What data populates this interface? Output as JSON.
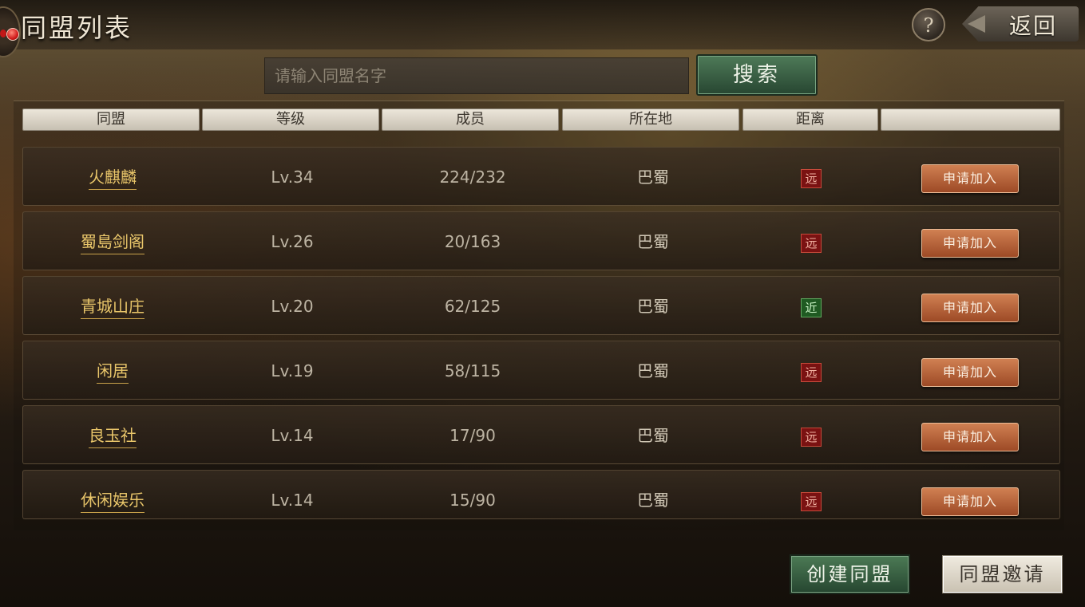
{
  "header": {
    "title": "同盟列表",
    "help_label": "?",
    "back_label": "返回"
  },
  "search": {
    "placeholder": "请输入同盟名字",
    "button_label": "搜索"
  },
  "columns": [
    "同盟",
    "等级",
    "成员",
    "所在地",
    "距离",
    ""
  ],
  "rows": [
    {
      "name": "火麒麟",
      "level": "Lv.34",
      "members": "224/232",
      "location": "巴蜀",
      "distance": "远",
      "action": "申请加入"
    },
    {
      "name": "蜀島剑阁",
      "level": "Lv.26",
      "members": "20/163",
      "location": "巴蜀",
      "distance": "远",
      "action": "申请加入"
    },
    {
      "name": "青城山庄",
      "level": "Lv.20",
      "members": "62/125",
      "location": "巴蜀",
      "distance": "近",
      "action": "申请加入"
    },
    {
      "name": "闲居",
      "level": "Lv.19",
      "members": "58/115",
      "location": "巴蜀",
      "distance": "远",
      "action": "申请加入"
    },
    {
      "name": "良玉社",
      "level": "Lv.14",
      "members": "17/90",
      "location": "巴蜀",
      "distance": "远",
      "action": "申请加入"
    },
    {
      "name": "休闲娱乐",
      "level": "Lv.14",
      "members": "15/90",
      "location": "巴蜀",
      "distance": "远",
      "action": "申请加入"
    }
  ],
  "footer": {
    "create_label": "创建同盟",
    "invite_label": "同盟邀请"
  },
  "colors": {
    "far": "#7a1212",
    "near": "#1f5a22",
    "accent_gold": "#e9c66a",
    "join_button": "#c06a3e"
  }
}
